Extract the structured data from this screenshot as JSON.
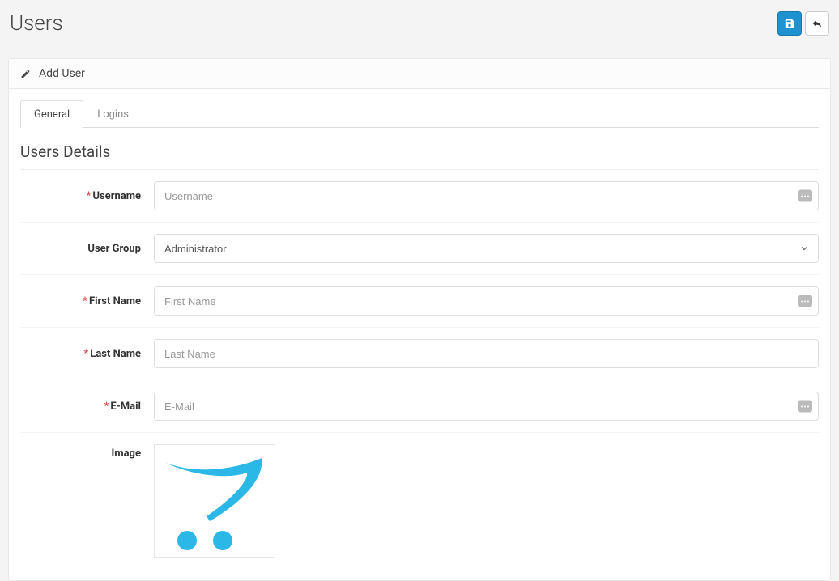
{
  "header": {
    "title": "Users",
    "save_title": "Save",
    "back_title": "Cancel"
  },
  "panel": {
    "heading": "Add User"
  },
  "tabs": [
    {
      "label": "General",
      "active": true
    },
    {
      "label": "Logins",
      "active": false
    }
  ],
  "section_title": "Users Details",
  "fields": {
    "username": {
      "label": "Username",
      "placeholder": "Username",
      "required": true,
      "value": ""
    },
    "user_group": {
      "label": "User Group",
      "selected": "Administrator",
      "required": false,
      "options": [
        "Administrator"
      ]
    },
    "first_name": {
      "label": "First Name",
      "placeholder": "First Name",
      "required": true,
      "value": ""
    },
    "last_name": {
      "label": "Last Name",
      "placeholder": "Last Name",
      "required": true,
      "value": ""
    },
    "email": {
      "label": "E-Mail",
      "placeholder": "E-Mail",
      "required": true,
      "value": ""
    },
    "image": {
      "label": "Image"
    }
  }
}
